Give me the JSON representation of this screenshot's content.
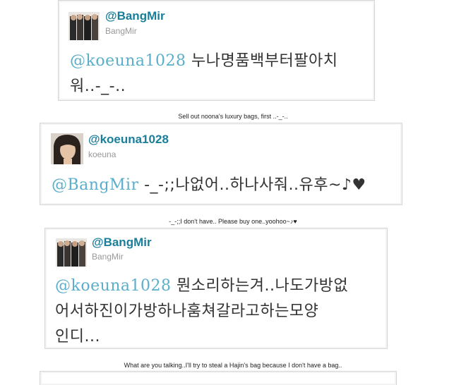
{
  "tweets": [
    {
      "handle": "@BangMir",
      "display_name": "BangMir",
      "mention": "@koeuna1028",
      "text_line1": " 누나명품백부터팔아치",
      "text_line2": "워..-_-..",
      "text_line3": "",
      "caption": "Sell out noona's luxury bags, first ..-_-.."
    },
    {
      "handle": "@koeuna1028",
      "display_name": "koeuna",
      "mention": "@BangMir",
      "text_line1": " -_-;;나없어..하나사줘..유후~♪♥",
      "text_line2": "",
      "text_line3": "",
      "caption": "-_-;;I don't have.. Please buy one..yoohoo~♪♥"
    },
    {
      "handle": "@BangMir",
      "display_name": "BangMir",
      "mention": "@koeuna1028",
      "text_line1": " 뭔소리하는겨..나도가방없",
      "text_line2": "어서하진이가방하나훔쳐갈라고하는모양",
      "text_line3": "인디...",
      "caption": "What are you talking..I'll try to steal a Hajin's bag because I don't have a bag.."
    }
  ],
  "colors": {
    "handle": "#1a7e9a",
    "mention": "#5aaecb",
    "text": "#333333",
    "display_name": "#999999"
  }
}
